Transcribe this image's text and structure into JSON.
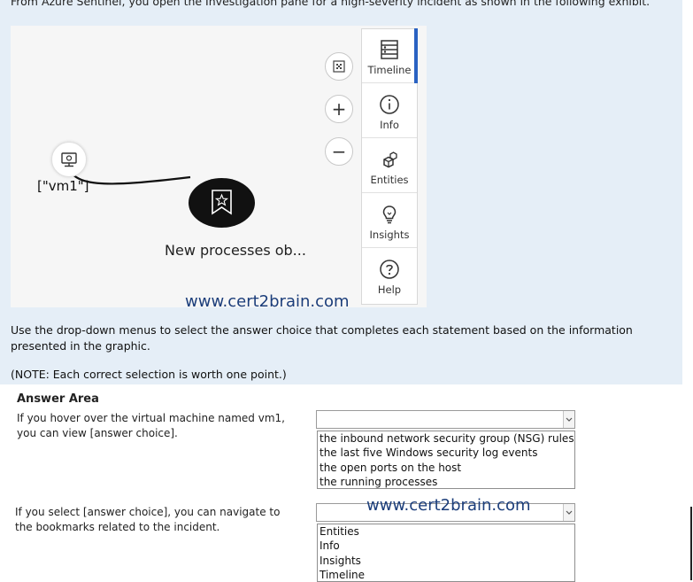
{
  "question": {
    "intro": "From Azure Sentinel, you open the Investigation pane for a high-severity incident as shown in the following exhibit.",
    "instruction": "Use the drop-down menus to select the answer choice that completes each statement based on the information presented in the graphic.",
    "note": "(NOTE: Each correct selection is worth one point.)"
  },
  "exhibit": {
    "vm_label": "[\"vm1\"]",
    "alert_label": "New processes ob...",
    "watermark": "www.cert2brain.com",
    "zoom_buttons": [
      "fit-to-screen",
      "zoom-in",
      "zoom-out"
    ],
    "panel_items": [
      {
        "label": "Timeline",
        "icon": "timeline-icon",
        "active": true
      },
      {
        "label": "Info",
        "icon": "info-icon",
        "active": false
      },
      {
        "label": "Entities",
        "icon": "entities-icon",
        "active": false
      },
      {
        "label": "Insights",
        "icon": "insights-icon",
        "active": false
      },
      {
        "label": "Help",
        "icon": "help-icon",
        "active": false
      }
    ],
    "colors": {
      "active_bar": "#2a62c2",
      "alert_node": "#111111",
      "watermark": "#1b3d7a",
      "band": "#e5eef7"
    }
  },
  "answer_area": {
    "title": "Answer Area",
    "statements": [
      {
        "text": "If you hover over the virtual machine named vm1, you can view [answer choice].",
        "selected": "",
        "options": [
          "the inbound network security group (NSG) rules",
          "the last five Windows security log events",
          "the open ports on the host",
          "the running processes"
        ]
      },
      {
        "text": "If you select [answer choice], you can navigate to the bookmarks related to the incident.",
        "selected": "",
        "options": [
          "Entities",
          "Info",
          "Insights",
          "Timeline"
        ]
      }
    ],
    "watermark": "www.cert2brain.com"
  }
}
